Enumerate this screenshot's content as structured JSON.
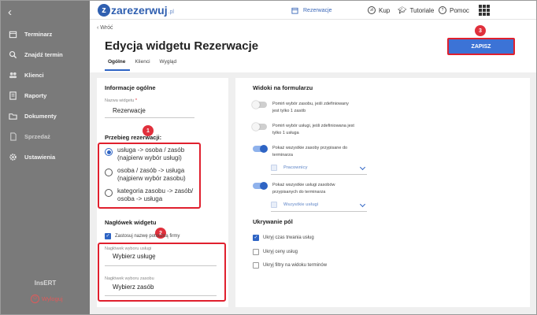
{
  "sidebar": {
    "items": [
      {
        "label": "Terminarz",
        "icon": "calendar-icon"
      },
      {
        "label": "Znajdź termin",
        "icon": "search-icon"
      },
      {
        "label": "Klienci",
        "icon": "users-icon"
      },
      {
        "label": "Raporty",
        "icon": "report-icon"
      },
      {
        "label": "Dokumenty",
        "icon": "folder-icon"
      },
      {
        "label": "Sprzedaż",
        "icon": "document-icon"
      },
      {
        "label": "Ustawienia",
        "icon": "gear-icon"
      }
    ],
    "brand": "InsERT",
    "logout": "Wyloguj"
  },
  "topbar": {
    "logo": "zarezerwuj",
    "logo_suffix": ".pl",
    "reservations": "Rezerwacje",
    "buy": "Kup",
    "tutorials": "Tutoriale",
    "help": "Pomoc"
  },
  "header": {
    "back": "‹ Wróć",
    "title": "Edycja widgetu Rezerwacje",
    "save": "ZAPISZ",
    "tabs": [
      "Ogólne",
      "Klienci",
      "Wygląd"
    ]
  },
  "left": {
    "general_title": "Informacje ogólne",
    "widget_name_label": "Nazwa widgetu",
    "widget_name_req": "*",
    "widget_name_value": "Rezerwacje",
    "flow_title": "Przebieg rezerwacji:",
    "radio_options": [
      {
        "text": "usługa -> osoba / zasób\n(najpierw wybór usługi)",
        "selected": true
      },
      {
        "text": "osoba / zasób -> usługa\n(najpierw wybór zasobu)",
        "selected": false
      },
      {
        "text": "kategoria zasobu -> zasób/\nosoba -> usługa",
        "selected": false
      }
    ],
    "headers_title": "Nagłówek widgetu",
    "use_company_name": "Zastosuj nazwę potoczną firmy",
    "service_header_label": "Nagłówek wyboru usługi",
    "service_header_value": "Wybierz usługę",
    "resource_header_label": "Nagłówek wyboru zasobu",
    "resource_header_value": "Wybierz zasób"
  },
  "right": {
    "views_title": "Widoki na formularzu",
    "toggles": [
      {
        "text": "Pomiń wybór zasobu, jeśli zdefiniowany\njest tylko 1 zasób",
        "on": false
      },
      {
        "text": "Pomiń wybór usługi, jeśli zdefiniowana jest\ntylko 1 usługa",
        "on": false
      },
      {
        "text": "Pokaż wszystkie zasoby przypisane do\nterminarza",
        "on": true
      },
      {
        "text": "Pokaż wszystkie usługi zasobów\nprzypisanych do terminarza",
        "on": true
      }
    ],
    "select_workers": "Pracownicy",
    "select_services": "Wszystkie usługi",
    "hiding_title": "Ukrywanie pól",
    "checks": [
      {
        "text": "Ukryj czas trwania usług",
        "checked": true
      },
      {
        "text": "Ukryj ceny usług",
        "checked": false
      },
      {
        "text": "Ukryj filtry na widoku terminów",
        "checked": false
      }
    ]
  },
  "callouts": [
    "1",
    "2",
    "3"
  ],
  "colors": {
    "accent": "#2e64c4",
    "callout": "#e0202e",
    "sidebar": "#7a7a7a"
  }
}
